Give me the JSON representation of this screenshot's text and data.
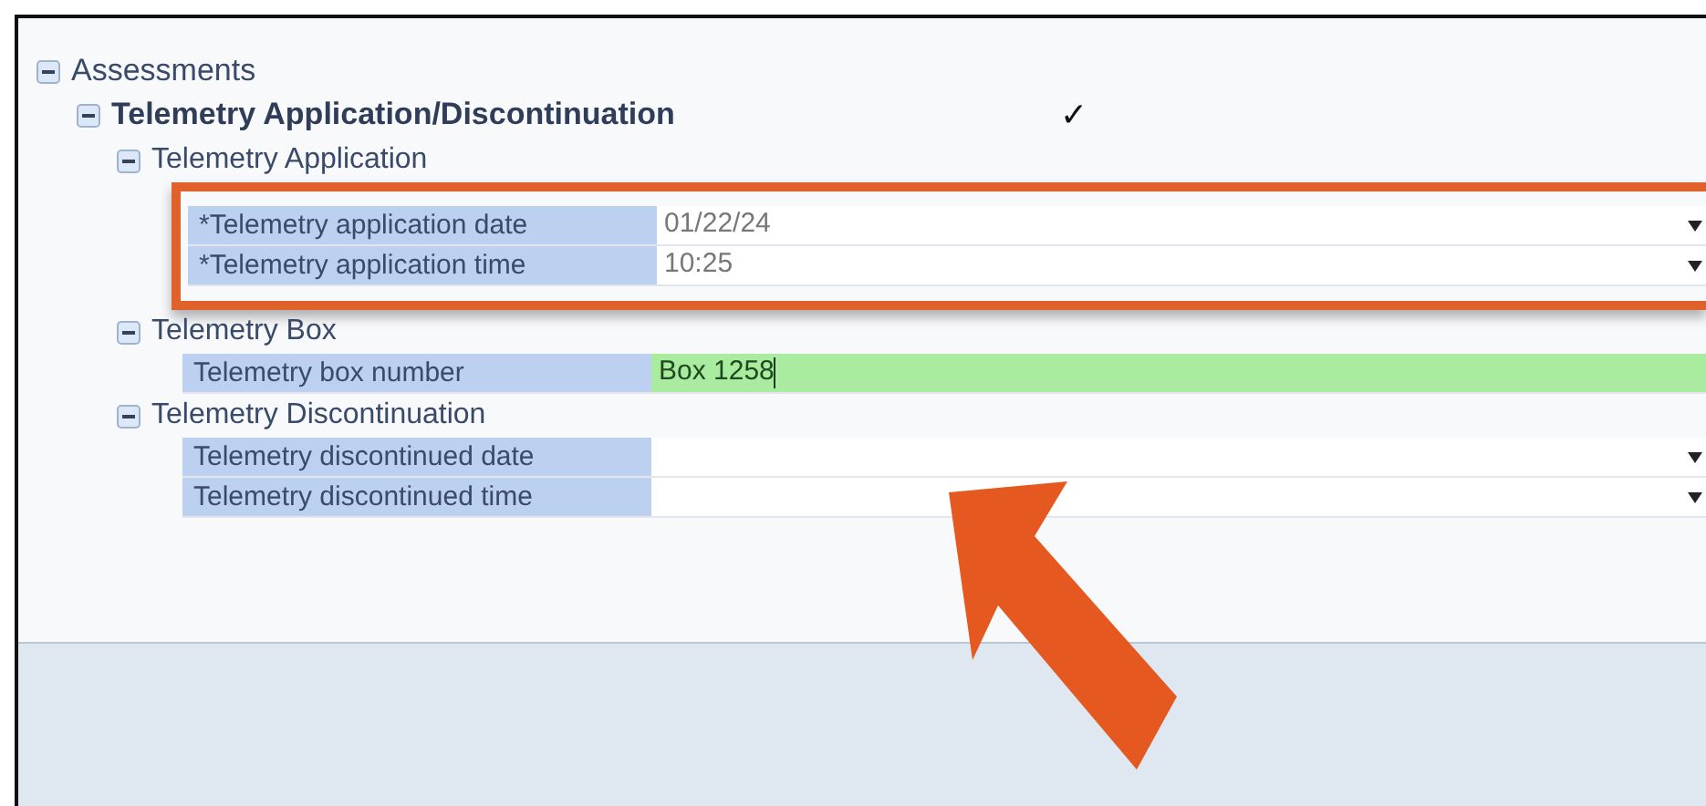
{
  "tree": {
    "label": "Assessments",
    "expanded": true,
    "children": [
      {
        "label": "Telemetry Application/Discontinuation",
        "expanded": true,
        "check": "✓",
        "groups": [
          {
            "label": "Telemetry Application",
            "expanded": true,
            "highlighted": true,
            "fields": [
              {
                "label": "*Telemetry application date",
                "value": "01/22/24",
                "kind": "dropdown",
                "active": false
              },
              {
                "label": "*Telemetry application time",
                "value": "10:25",
                "kind": "dropdown",
                "active": false
              }
            ]
          },
          {
            "label": "Telemetry Box",
            "expanded": true,
            "highlighted": false,
            "fields": [
              {
                "label": "Telemetry box number",
                "value": "Box 1258",
                "kind": "text",
                "active": true
              }
            ]
          },
          {
            "label": "Telemetry Discontinuation",
            "expanded": true,
            "highlighted": false,
            "fields": [
              {
                "label": "Telemetry discontinued date",
                "kind": "dropdown",
                "active": false
              },
              {
                "label": "Telemetry discontinued time",
                "kind": "dropdown",
                "active": false
              }
            ]
          }
        ]
      }
    ]
  }
}
